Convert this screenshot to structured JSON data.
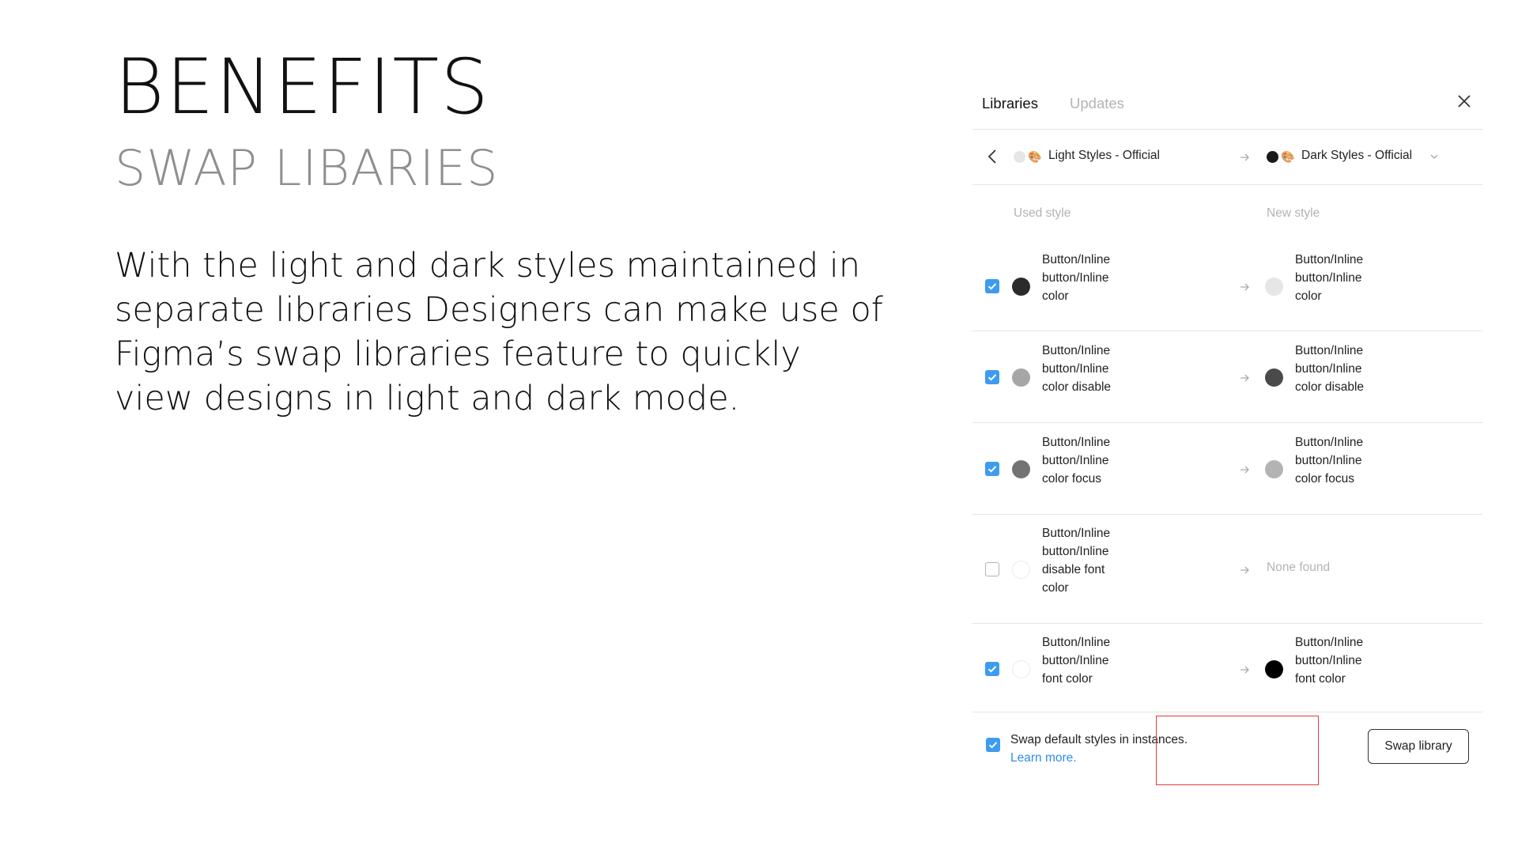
{
  "slide": {
    "title": "BENEFITS",
    "subtitle": "SWAP LIBARIES",
    "body": "With the light and dark styles maintained in separate libraries Designers can make use of Figma’s swap libraries feature to quickly view designs in light and dark mode."
  },
  "panel": {
    "tabs": [
      {
        "label": "Libraries",
        "active": true
      },
      {
        "label": "Updates",
        "active": false
      }
    ],
    "source_library": {
      "name": "Light Styles - Official",
      "dot_color": "#e6e6e6"
    },
    "target_library": {
      "name": "Dark Styles - Official",
      "dot_color": "#1a1a1a"
    },
    "columns": {
      "used": "Used style",
      "new": "New style"
    },
    "rows": [
      {
        "checked": true,
        "used": {
          "lines": [
            "Button/Inline",
            "button/Inline",
            "color"
          ],
          "color": "#2b2b2b"
        },
        "new": {
          "lines": [
            "Button/Inline",
            "button/Inline",
            "color"
          ],
          "color": "#e6e6e6"
        }
      },
      {
        "checked": true,
        "used": {
          "lines": [
            "Button/Inline",
            "button/Inline",
            "color disable"
          ],
          "color": "#a6a6a6"
        },
        "new": {
          "lines": [
            "Button/Inline",
            "button/Inline",
            "color disable"
          ],
          "color": "#4a4a4a"
        }
      },
      {
        "checked": true,
        "used": {
          "lines": [
            "Button/Inline",
            "button/Inline",
            "color focus"
          ],
          "color": "#737373"
        },
        "new": {
          "lines": [
            "Button/Inline",
            "button/Inline",
            "color focus"
          ],
          "color": "#b3b3b3"
        }
      },
      {
        "checked": false,
        "used": {
          "lines": [
            "Button/Inline",
            "button/Inline",
            "disable font",
            "color"
          ],
          "color": "#ffffff"
        },
        "new": {
          "none_text": "None found"
        }
      },
      {
        "checked": true,
        "used": {
          "lines": [
            "Button/Inline",
            "button/Inline",
            "font color"
          ],
          "color": "#ffffff"
        },
        "new": {
          "lines": [
            "Button/Inline",
            "button/Inline",
            "font color"
          ],
          "color": "#000000"
        }
      }
    ],
    "footer": {
      "checked": true,
      "text": "Swap default styles in instances.",
      "link": "Learn more.",
      "button": "Swap library"
    },
    "accent_color": "#3d9cf0",
    "highlight_color": "#e03b3b"
  }
}
